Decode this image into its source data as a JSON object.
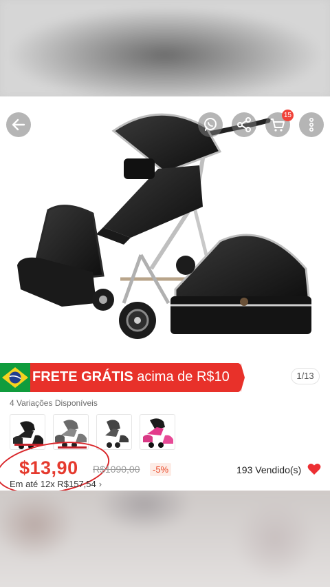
{
  "toolbar": {
    "back_icon": "arrow-left-icon",
    "whatsapp_icon": "whatsapp-icon",
    "share_icon": "share-icon",
    "cart_icon": "cart-icon",
    "cart_count": "15",
    "more_icon": "more-vertical-icon"
  },
  "gallery": {
    "page_indicator": "1/13"
  },
  "shipping_banner": {
    "bold_text": "FRETE GRÁTIS",
    "rest_text": "acima de R$10"
  },
  "variations": {
    "label": "4 Variações Disponíveis",
    "count": 4
  },
  "pricing": {
    "price": "$13,90",
    "old_price": "R$1090,00",
    "discount": "-5%",
    "installment": "Em até 12x R$157,54",
    "sold": "193 Vendido(s)"
  },
  "colors": {
    "accent_red": "#e8312a",
    "price_red": "#e53a2e",
    "flag_green": "#0f9a3c"
  }
}
